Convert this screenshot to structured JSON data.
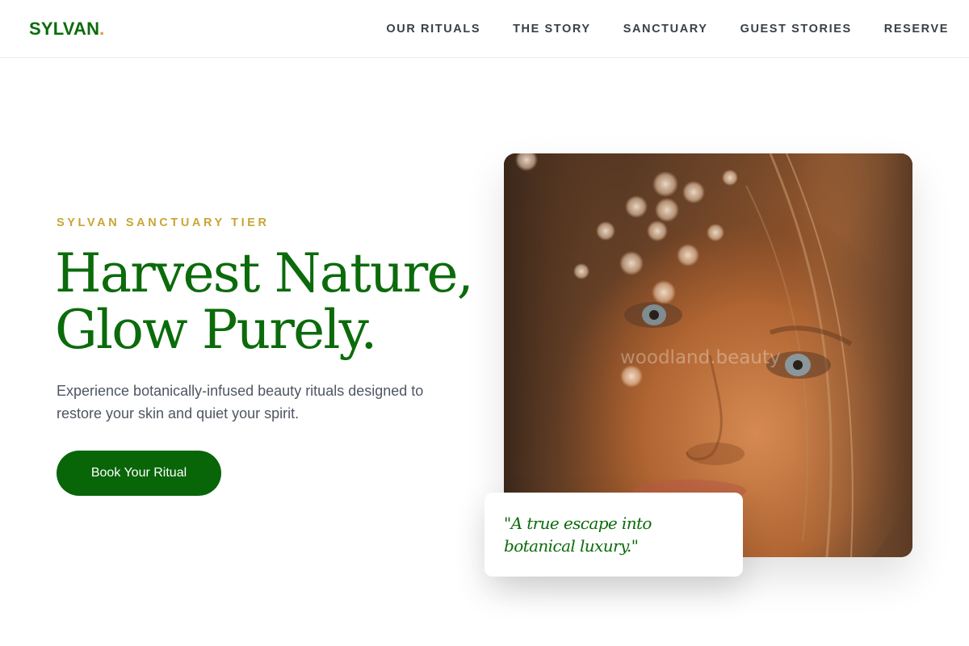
{
  "brand": {
    "name": "SYLVAN",
    "dot": ".",
    "primary_color": "#0b6b0b",
    "accent_color": "#c9a534"
  },
  "nav": {
    "items": [
      {
        "label": "OUR RITUALS"
      },
      {
        "label": "THE STORY"
      },
      {
        "label": "SANCTUARY"
      },
      {
        "label": "GUEST STORIES"
      },
      {
        "label": "RESERVE"
      }
    ]
  },
  "hero": {
    "eyebrow": "SYLVAN SANCTUARY TIER",
    "headline_line1": "Harvest Nature,",
    "headline_line2": "Glow Purely.",
    "subtext": "Experience botanically-infused beauty rituals designed to restore your skin and quiet your spirit.",
    "cta_label": "Book Your Ritual",
    "cta_color": "#086508"
  },
  "image": {
    "alt": "woodland.beauty",
    "watermark": "woodland.beauty"
  },
  "testimonial": {
    "quote": "\"A true escape into botanical luxury.\""
  }
}
